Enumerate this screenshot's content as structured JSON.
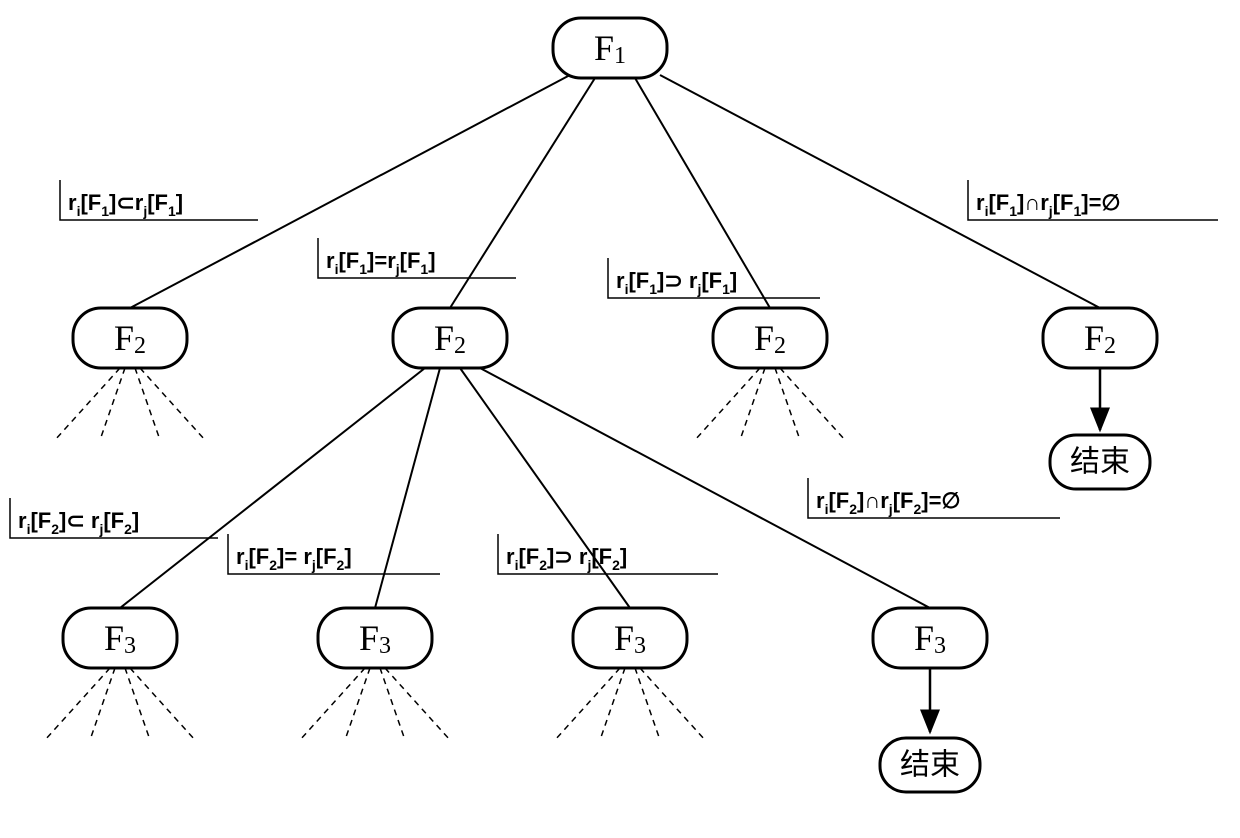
{
  "nodes": {
    "root": {
      "label_main": "F",
      "label_sub": "1"
    },
    "l2_a": {
      "label_main": "F",
      "label_sub": "2"
    },
    "l2_b": {
      "label_main": "F",
      "label_sub": "2"
    },
    "l2_c": {
      "label_main": "F",
      "label_sub": "2"
    },
    "l2_d": {
      "label_main": "F",
      "label_sub": "2"
    },
    "end1": {
      "label": "结束"
    },
    "l3_a": {
      "label_main": "F",
      "label_sub": "3"
    },
    "l3_b": {
      "label_main": "F",
      "label_sub": "3"
    },
    "l3_c": {
      "label_main": "F",
      "label_sub": "3"
    },
    "l3_d": {
      "label_main": "F",
      "label_sub": "3"
    },
    "end2": {
      "label": "结束"
    }
  },
  "conditions": {
    "c1a": {
      "ri": "r",
      "i": "i",
      "lf": "[F",
      "k1": "1",
      "op": "⊂",
      "rj": "r",
      "j": "j",
      "rf": "[F",
      "k2": "1",
      "tail": "]"
    },
    "c1b": {
      "ri": "r",
      "i": "i",
      "lf": "[F",
      "k1": "1",
      "op": "=",
      "rj": "r",
      "j": "j",
      "rf": "[F",
      "k2": "1",
      "tail": "]"
    },
    "c1c": {
      "ri": "r",
      "i": "i",
      "lf": "[F",
      "k1": "1",
      "op": "⊃",
      "rj": "r",
      "j": "j",
      "rf": "[F",
      "k2": "1",
      "tail": "]"
    },
    "c1d": {
      "ri": "r",
      "i": "i",
      "lf": "[F",
      "k1": "1",
      "op": "∩",
      "rj": "r",
      "j": "j",
      "rf": "[F",
      "k2": "1",
      "tail": "]=∅"
    },
    "c2a": {
      "ri": "r",
      "i": "i",
      "lf": "[F",
      "k1": "2",
      "op": "⊂",
      "rj": "r",
      "j": "j",
      "rf": "[F",
      "k2": "2",
      "tail": "]"
    },
    "c2b": {
      "ri": "r",
      "i": "i",
      "lf": "[F",
      "k1": "2",
      "op": "=",
      "rj": "r",
      "j": "j",
      "rf": "[F",
      "k2": "2",
      "tail": "]"
    },
    "c2c": {
      "ri": "r",
      "i": "i",
      "lf": "[F",
      "k1": "2",
      "op": "⊃",
      "rj": "r",
      "j": "j",
      "rf": "[F",
      "k2": "2",
      "tail": "]"
    },
    "c2d": {
      "ri": "r",
      "i": "i",
      "lf": "[F",
      "k1": "2",
      "op": "∩",
      "rj": "r",
      "j": "j",
      "rf": "[F",
      "k2": "2",
      "tail": "]=∅"
    }
  }
}
